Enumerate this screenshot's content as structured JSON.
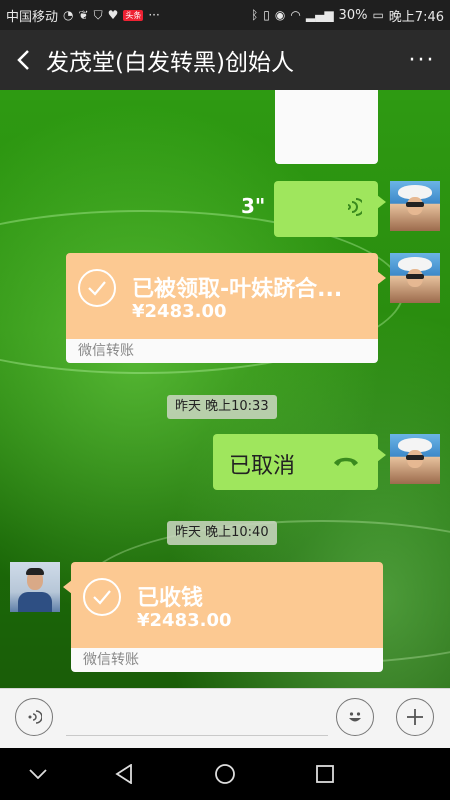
{
  "status_bar": {
    "carrier": "中国移动",
    "battery": "30%",
    "time": "晚上7:46",
    "app_badge": "头条"
  },
  "header": {
    "title": "发茂堂(白发转黑)创始人",
    "more": "···"
  },
  "messages": {
    "voice": {
      "duration": "3\""
    },
    "transfer_received": {
      "title": "已被领取-叶妹跻合...",
      "amount": "¥2483.00",
      "footer": "微信转账"
    },
    "timestamp_1": "昨天 晚上10:33",
    "call": {
      "text": "已取消"
    },
    "timestamp_2": "昨天 晚上10:40",
    "transfer_collected": {
      "title": "已收钱",
      "amount": "¥2483.00",
      "footer": "微信转账"
    }
  },
  "input_bar": {
    "placeholder": ""
  },
  "colors": {
    "sent_bubble": "#9fe65d",
    "transfer_bubble": "#fcc992",
    "title_bar": "#2b2b2b",
    "status_bar": "#1f1f1f"
  }
}
